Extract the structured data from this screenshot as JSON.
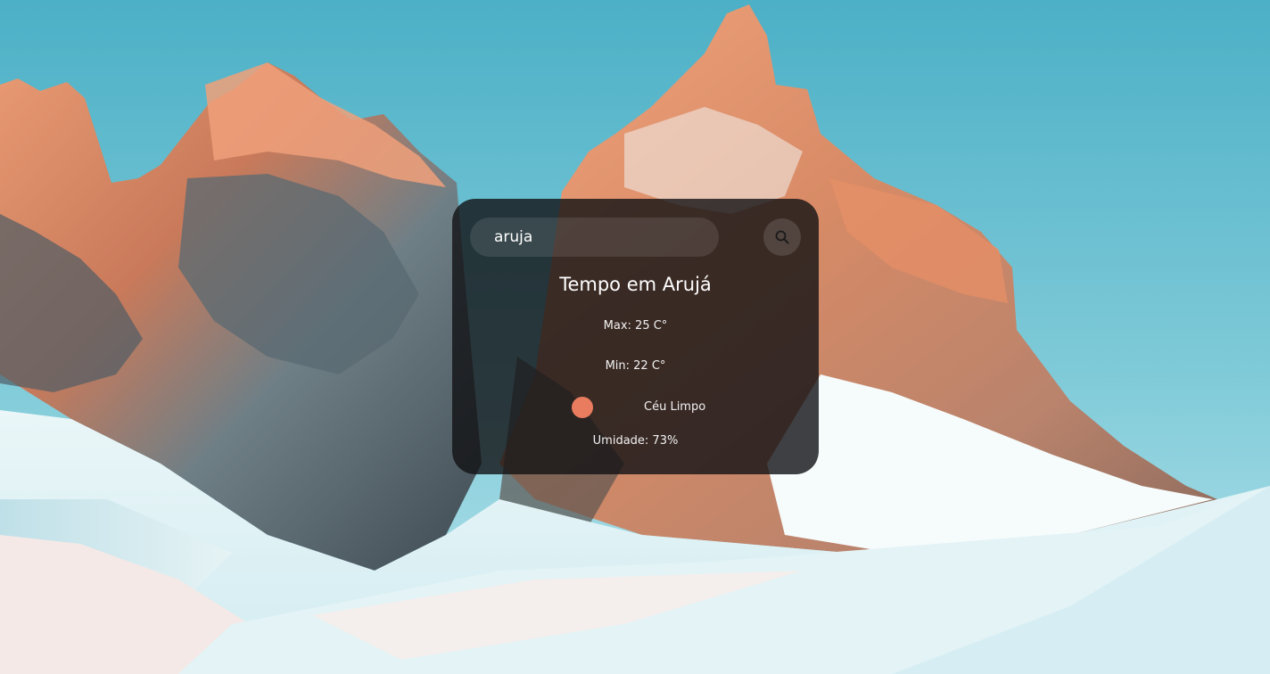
{
  "search": {
    "value": "aruja",
    "button_icon": "search-icon"
  },
  "weather": {
    "title": "Tempo em Arujá",
    "max": "Max: 25 C°",
    "min": "Min: 22 C°",
    "icon": "sun-icon",
    "description": "Céu Limpo",
    "humidity": "Umidade: 73%"
  },
  "colors": {
    "card_background": "#121214",
    "sun_icon": "#e97b5f",
    "sky": "#4fb3c8"
  }
}
